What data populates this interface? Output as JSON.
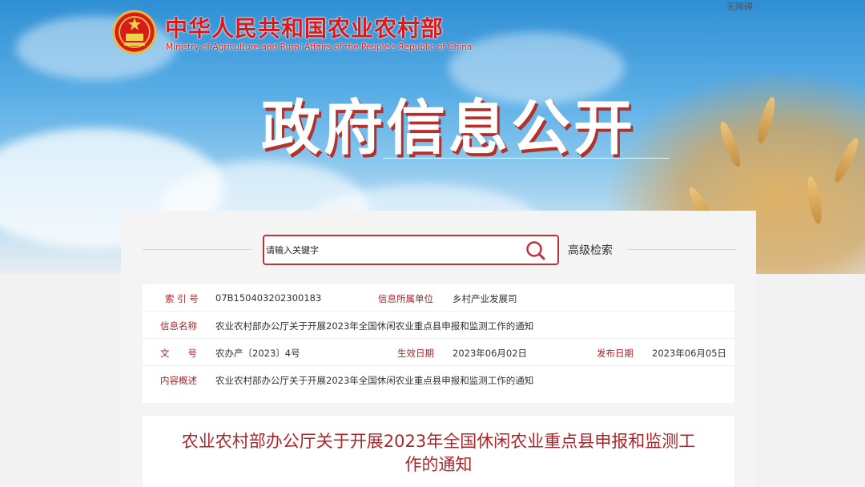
{
  "header": {
    "logo_cn": "中华人民共和国农业农村部",
    "logo_en": "Ministry of Agriculture and Rural Affairs of the People's Republic of China",
    "accessibility": "无障碍",
    "emblem_icon": "national-emblem-icon"
  },
  "hero": {
    "title": "政府信息公开"
  },
  "search": {
    "placeholder": "请输入关键字",
    "advanced_label": "高级检索",
    "icon": "search-icon"
  },
  "info": {
    "index_label": "索 引 号",
    "index_value": "07B150403202300183",
    "unit_label": "信息所属单位",
    "unit_value": "乡村产业发展司",
    "name_label": "信息名称",
    "name_value": "农业农村部办公厅关于开展2023年全国休闲农业重点县申报和监测工作的通知",
    "docno_label": "文　　号",
    "docno_value": "农办产〔2023〕4号",
    "effective_label": "生效日期",
    "effective_value": "2023年06月02日",
    "publish_label": "发布日期",
    "publish_value": "2023年06月05日",
    "summary_label": "内容概述",
    "summary_value": "农业农村部办公厅关于开展2023年全国休闲农业重点县申报和监测工作的通知"
  },
  "document": {
    "title": "农业农村部办公厅关于开展2023年全国休闲农业重点县申报和监测工作的通知"
  },
  "colors": {
    "brand_red": "#d71a1a",
    "label_red": "#a8272c",
    "search_border": "#b8333a"
  }
}
